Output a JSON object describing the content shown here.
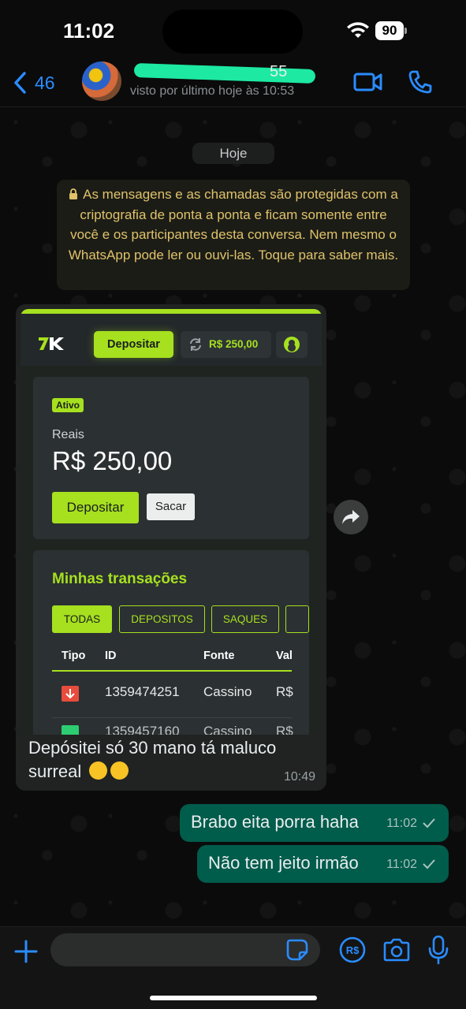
{
  "status_bar": {
    "time": "11:02",
    "battery": "90"
  },
  "header": {
    "back_count": "46",
    "contact_name_tail": "55",
    "last_seen": "visto por último hoje às 10:53"
  },
  "chat": {
    "date_chip": "Hoje",
    "encryption_notice": "As mensagens e as chamadas são protegidas com a criptografia de ponta a ponta e ficam somente entre você e os participantes desta conversa. Nem mesmo o WhatsApp pode ler ou ouvi-las. Toque para saber mais.",
    "incoming": {
      "screenshot": {
        "nav_deposit_label": "Depositar",
        "nav_balance": "R$ 250,00",
        "badge": "Ativo",
        "currency_label": "Reais",
        "balance": "R$ 250,00",
        "deposit_button": "Depositar",
        "withdraw_button": "Sacar",
        "transactions_title": "Minhas transações",
        "filters": [
          "TODAS",
          "DEPOSITOS",
          "SAQUES"
        ],
        "columns": [
          "Tipo",
          "ID",
          "Fonte",
          "Val"
        ],
        "rows": [
          {
            "id": "1359474251",
            "source": "Cassino",
            "value": "R$"
          }
        ],
        "partial_row": {
          "id": "1359457160",
          "source": "Cassino",
          "value": "R$"
        }
      },
      "caption": "Depósitei só 30 mano tá maluco surreal",
      "time": "10:49"
    },
    "outgoing": [
      {
        "text": "Brabo eita porra haha",
        "time": "11:02"
      },
      {
        "text": "Não tem jeito irmão",
        "time": "11:02"
      }
    ]
  },
  "colors": {
    "accent_green": "#a6e01f",
    "whatsapp_blue": "#2a8cff",
    "outgoing_bubble": "#005c4b"
  }
}
